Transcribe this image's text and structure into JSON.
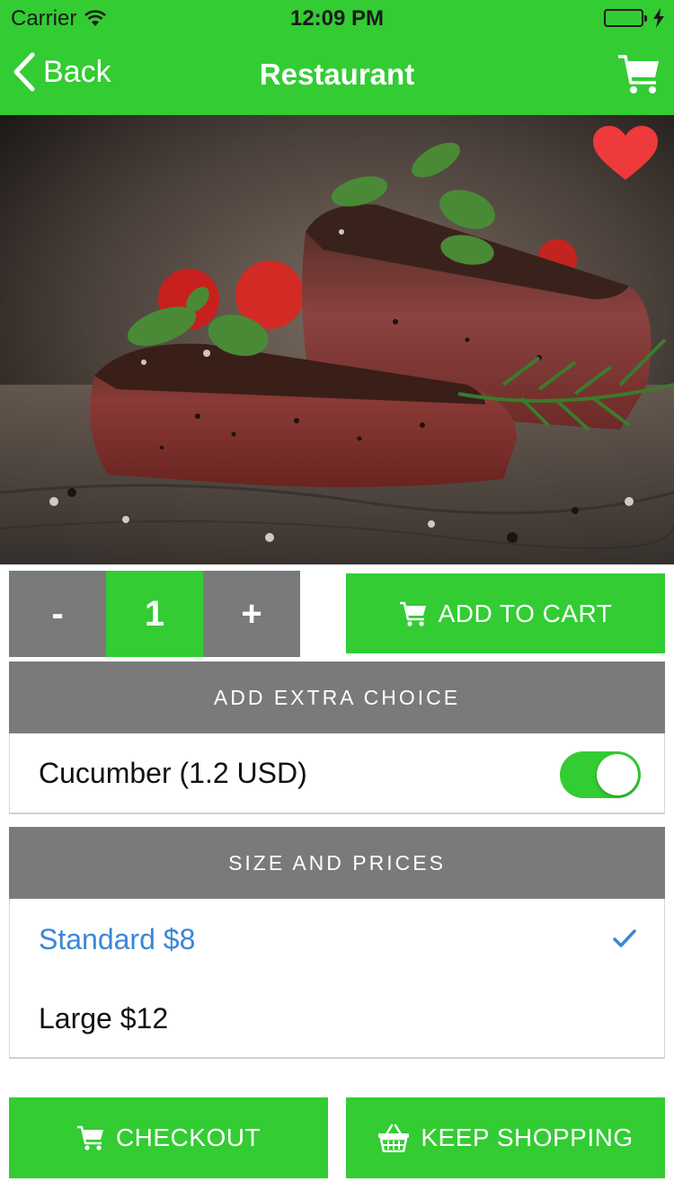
{
  "status_bar": {
    "carrier": "Carrier",
    "time": "12:09 PM",
    "icons": [
      "wifi-icon",
      "battery-icon",
      "charging-icon"
    ]
  },
  "nav": {
    "back_label": "Back",
    "title": "Restaurant",
    "cart_icon": "cart-icon"
  },
  "hero": {
    "favorite_icon": "heart-icon",
    "favorite_color": "#ee3a3a"
  },
  "quantity": {
    "minus_label": "-",
    "value": "1",
    "plus_label": "+"
  },
  "add_to_cart": {
    "label": "ADD TO CART",
    "icon": "cart-icon"
  },
  "extra_choice": {
    "header": "ADD EXTRA CHOICE",
    "items": [
      {
        "label": "Cucumber (1.2 USD)",
        "enabled": true
      }
    ]
  },
  "size_prices": {
    "header": "SIZE AND PRICES",
    "options": [
      {
        "label": "Standard $8",
        "selected": true
      },
      {
        "label": "Large $12",
        "selected": false
      }
    ]
  },
  "footer": {
    "checkout_label": "CHECKOUT",
    "checkout_icon": "cart-icon",
    "keep_shopping_label": "KEEP SHOPPING",
    "keep_shopping_icon": "basket-icon"
  },
  "colors": {
    "primary_green": "#33cc33",
    "gray": "#7a7a7a",
    "selected_blue": "#3a86d8"
  }
}
